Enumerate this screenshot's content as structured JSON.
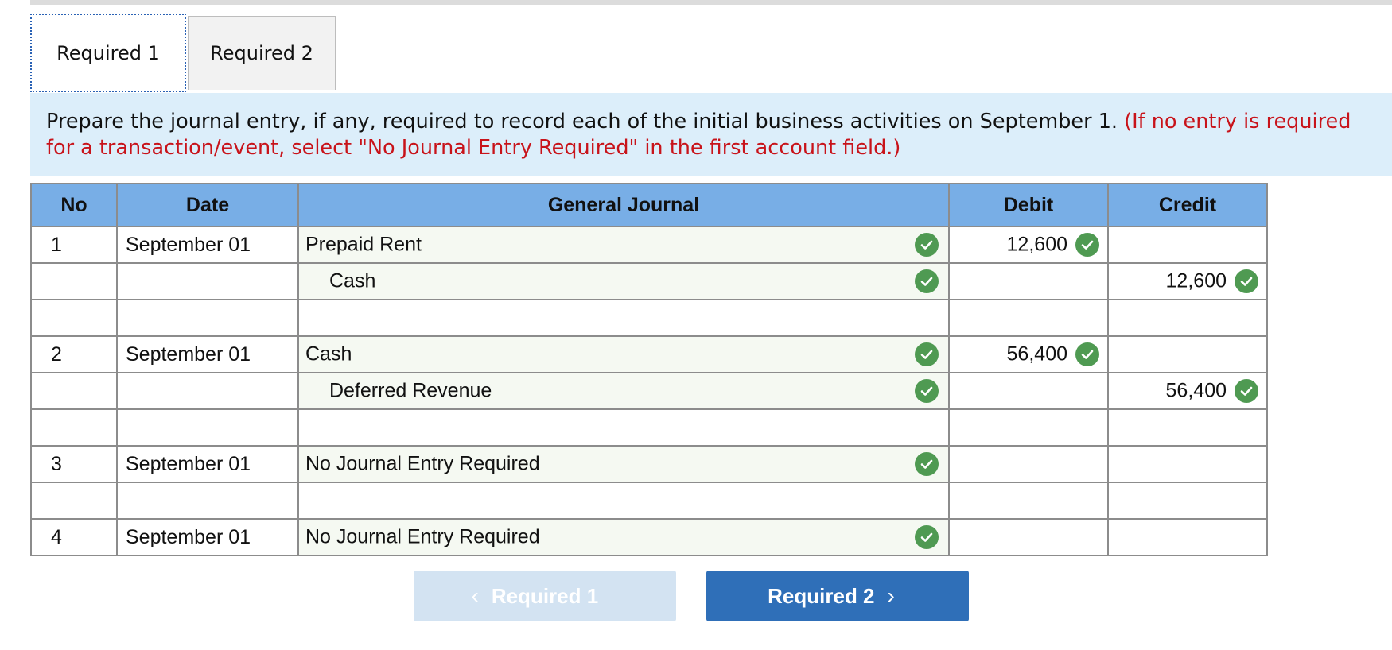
{
  "tabs": [
    {
      "label": "Required 1",
      "active": true
    },
    {
      "label": "Required 2",
      "active": false
    }
  ],
  "instructions": {
    "main": "Prepare the journal entry, if any, required to record each of the initial business activities on September 1.",
    "note": "(If no entry is required for a transaction/event, select \"No Journal Entry Required\" in the first account field.)"
  },
  "table": {
    "headers": {
      "no": "No",
      "date": "Date",
      "journal": "General Journal",
      "debit": "Debit",
      "credit": "Credit"
    },
    "rows": [
      {
        "no": "1",
        "date": "September 01",
        "account": "Prepaid Rent",
        "indent": false,
        "debit": "12,600",
        "credit": "",
        "account_check": true
      },
      {
        "no": "",
        "date": "",
        "account": "Cash",
        "indent": true,
        "debit": "",
        "credit": "12,600",
        "account_check": true
      },
      {
        "no": "",
        "date": "",
        "account": "",
        "indent": false,
        "debit": "",
        "credit": "",
        "account_check": false
      },
      {
        "no": "2",
        "date": "September 01",
        "account": "Cash",
        "indent": false,
        "debit": "56,400",
        "credit": "",
        "account_check": true
      },
      {
        "no": "",
        "date": "",
        "account": "Deferred Revenue",
        "indent": true,
        "debit": "",
        "credit": "56,400",
        "account_check": true
      },
      {
        "no": "",
        "date": "",
        "account": "",
        "indent": false,
        "debit": "",
        "credit": "",
        "account_check": false
      },
      {
        "no": "3",
        "date": "September 01",
        "account": "No Journal Entry Required",
        "indent": false,
        "debit": "",
        "credit": "",
        "account_check": true
      },
      {
        "no": "",
        "date": "",
        "account": "",
        "indent": false,
        "debit": "",
        "credit": "",
        "account_check": false
      },
      {
        "no": "4",
        "date": "September 01",
        "account": "No Journal Entry Required",
        "indent": false,
        "debit": "",
        "credit": "",
        "account_check": true
      }
    ]
  },
  "nav": {
    "prev_label": "Required 1",
    "next_label": "Required 2",
    "prev_icon": "chevron-left-icon",
    "next_icon": "chevron-right-icon"
  },
  "colors": {
    "header_bg": "#78aee6",
    "instruction_bg": "#dceefa",
    "note_red": "#c8131a",
    "check_green": "#4f9a52",
    "next_button": "#2f6fb8",
    "prev_button_disabled": "#d3e3f2"
  }
}
